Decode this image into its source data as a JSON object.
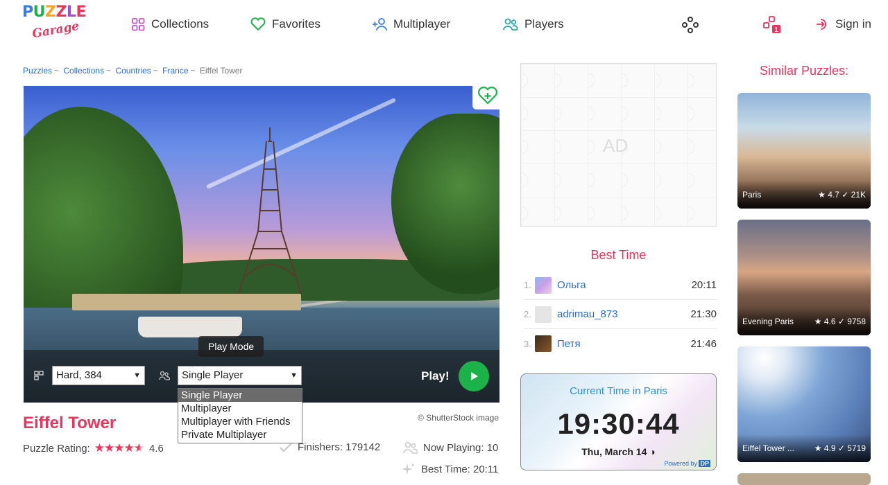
{
  "header": {
    "logo_top": "PUZZLE",
    "logo_bottom": "Garage",
    "nav": [
      {
        "label": "Collections"
      },
      {
        "label": "Favorites"
      },
      {
        "label": "Multiplayer"
      },
      {
        "label": "Players"
      }
    ],
    "sign_in": "Sign in",
    "notification_count": "1"
  },
  "breadcrumb": {
    "items": [
      "Puzzles",
      "Collections",
      "Countries",
      "France"
    ],
    "current": "Eiffel Tower"
  },
  "hero": {
    "play_mode_label": "Play Mode",
    "difficulty_value": "Hard, 384",
    "mode_value": "Single Player",
    "play_label": "Play!",
    "mode_options": [
      "Single Player",
      "Multiplayer",
      "Multiplayer with Friends",
      "Private Multiplayer"
    ]
  },
  "puzzle": {
    "title": "Eiffel Tower",
    "credit": "© ShutterStock image",
    "rating_label": "Puzzle Rating:",
    "rating_value": "4.6",
    "rating_stars": 4.6,
    "finishers": "Finishers: 179142",
    "now_playing": "Now Playing: 10",
    "best_time": "Best Time: 20:11"
  },
  "ad": {
    "label": "AD"
  },
  "best_time": {
    "title": "Best Time",
    "rows": [
      {
        "rank": "1.",
        "name": "Ольга",
        "time": "20:11"
      },
      {
        "rank": "2.",
        "name": "adrimau_873",
        "time": "21:30"
      },
      {
        "rank": "3.",
        "name": "Петя",
        "time": "21:46"
      }
    ]
  },
  "clock": {
    "title": "Current Time in Paris",
    "time": "19:30:44",
    "date": "Thu, March 14",
    "powered": "Powered by"
  },
  "similar": {
    "title": "Similar Puzzles:",
    "cards": [
      {
        "name": "Paris",
        "rating": "4.7",
        "finishers": "21K"
      },
      {
        "name": "Evening Paris",
        "rating": "4.6",
        "finishers": "9758"
      },
      {
        "name": "Eiffel Tower ...",
        "rating": "4.9",
        "finishers": "5719"
      }
    ]
  },
  "colors": {
    "accent": "#e8365d",
    "link": "#2a6fc6",
    "play": "#1cb24a"
  }
}
